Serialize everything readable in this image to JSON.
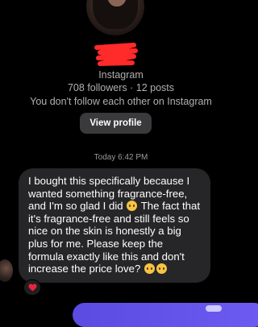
{
  "profile": {
    "platform": "Instagram",
    "followers_line": "708 followers · 12 posts",
    "follow_note": "You don't follow each other on Instagram",
    "view_profile_label": "View profile"
  },
  "thread": {
    "timestamp": "Today 6:42 PM",
    "message_segments": [
      "I bought this specifically because I wanted something fragrance-free, and I'm so glad I did ",
      " The fact that it's fragrance-free and still feels so nice on the skin is honestly a big plus for me. Please keep the formula exactly like this and don't increase the price love? "
    ],
    "reaction": "heart"
  },
  "colors": {
    "background": "#000000",
    "bubble_incoming": "#262628",
    "button": "#3a3a3c",
    "outgoing_gradient_start": "#5b4be0",
    "outgoing_gradient_end": "#6d5bf2",
    "redaction": "#ff2a2a",
    "heart": "#e8253b"
  }
}
